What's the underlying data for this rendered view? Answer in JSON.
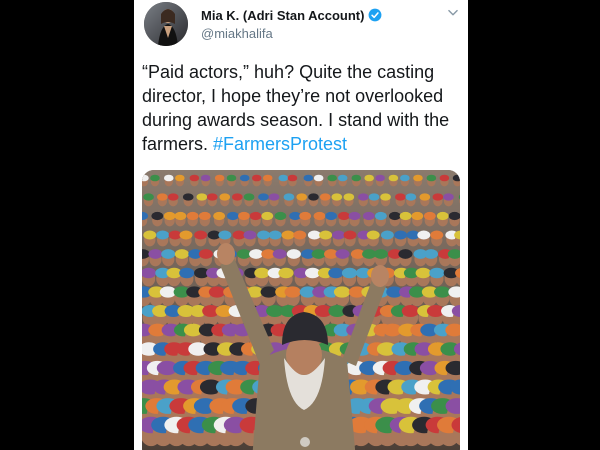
{
  "tweet": {
    "display_name": "Mia K. (Adri Stan Account)",
    "handle": "@miakhalifa",
    "verified": true,
    "text_main": "“Paid actors,” huh? Quite the casting director, I hope they’re not overlooked during awards season. I stand with the farmers. ",
    "hashtag": "#FarmersProtest",
    "icons": {
      "verified": "verified-badge-icon",
      "menu": "chevron-down-icon"
    },
    "colors": {
      "link": "#1da1f2",
      "verified": "#1da1f2",
      "text": "#14171a",
      "secondary": "#657786"
    }
  }
}
